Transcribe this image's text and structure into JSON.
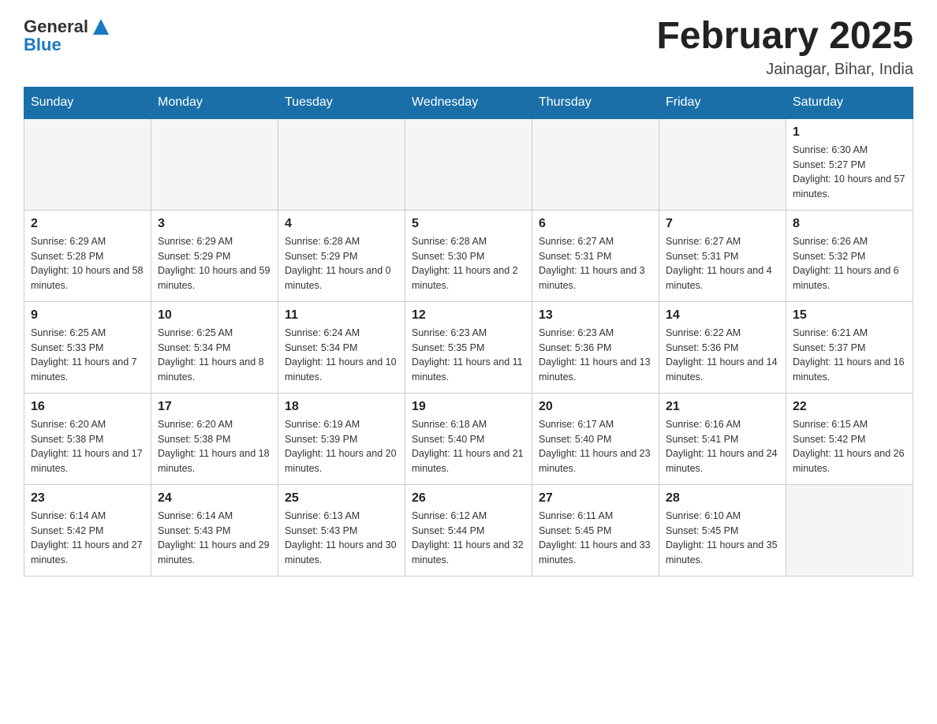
{
  "header": {
    "logo_general": "General",
    "logo_blue": "Blue",
    "month_title": "February 2025",
    "location": "Jainagar, Bihar, India"
  },
  "weekdays": [
    "Sunday",
    "Monday",
    "Tuesday",
    "Wednesday",
    "Thursday",
    "Friday",
    "Saturday"
  ],
  "weeks": [
    [
      {
        "day": "",
        "sunrise": "",
        "sunset": "",
        "daylight": ""
      },
      {
        "day": "",
        "sunrise": "",
        "sunset": "",
        "daylight": ""
      },
      {
        "day": "",
        "sunrise": "",
        "sunset": "",
        "daylight": ""
      },
      {
        "day": "",
        "sunrise": "",
        "sunset": "",
        "daylight": ""
      },
      {
        "day": "",
        "sunrise": "",
        "sunset": "",
        "daylight": ""
      },
      {
        "day": "",
        "sunrise": "",
        "sunset": "",
        "daylight": ""
      },
      {
        "day": "1",
        "sunrise": "Sunrise: 6:30 AM",
        "sunset": "Sunset: 5:27 PM",
        "daylight": "Daylight: 10 hours and 57 minutes."
      }
    ],
    [
      {
        "day": "2",
        "sunrise": "Sunrise: 6:29 AM",
        "sunset": "Sunset: 5:28 PM",
        "daylight": "Daylight: 10 hours and 58 minutes."
      },
      {
        "day": "3",
        "sunrise": "Sunrise: 6:29 AM",
        "sunset": "Sunset: 5:29 PM",
        "daylight": "Daylight: 10 hours and 59 minutes."
      },
      {
        "day": "4",
        "sunrise": "Sunrise: 6:28 AM",
        "sunset": "Sunset: 5:29 PM",
        "daylight": "Daylight: 11 hours and 0 minutes."
      },
      {
        "day": "5",
        "sunrise": "Sunrise: 6:28 AM",
        "sunset": "Sunset: 5:30 PM",
        "daylight": "Daylight: 11 hours and 2 minutes."
      },
      {
        "day": "6",
        "sunrise": "Sunrise: 6:27 AM",
        "sunset": "Sunset: 5:31 PM",
        "daylight": "Daylight: 11 hours and 3 minutes."
      },
      {
        "day": "7",
        "sunrise": "Sunrise: 6:27 AM",
        "sunset": "Sunset: 5:31 PM",
        "daylight": "Daylight: 11 hours and 4 minutes."
      },
      {
        "day": "8",
        "sunrise": "Sunrise: 6:26 AM",
        "sunset": "Sunset: 5:32 PM",
        "daylight": "Daylight: 11 hours and 6 minutes."
      }
    ],
    [
      {
        "day": "9",
        "sunrise": "Sunrise: 6:25 AM",
        "sunset": "Sunset: 5:33 PM",
        "daylight": "Daylight: 11 hours and 7 minutes."
      },
      {
        "day": "10",
        "sunrise": "Sunrise: 6:25 AM",
        "sunset": "Sunset: 5:34 PM",
        "daylight": "Daylight: 11 hours and 8 minutes."
      },
      {
        "day": "11",
        "sunrise": "Sunrise: 6:24 AM",
        "sunset": "Sunset: 5:34 PM",
        "daylight": "Daylight: 11 hours and 10 minutes."
      },
      {
        "day": "12",
        "sunrise": "Sunrise: 6:23 AM",
        "sunset": "Sunset: 5:35 PM",
        "daylight": "Daylight: 11 hours and 11 minutes."
      },
      {
        "day": "13",
        "sunrise": "Sunrise: 6:23 AM",
        "sunset": "Sunset: 5:36 PM",
        "daylight": "Daylight: 11 hours and 13 minutes."
      },
      {
        "day": "14",
        "sunrise": "Sunrise: 6:22 AM",
        "sunset": "Sunset: 5:36 PM",
        "daylight": "Daylight: 11 hours and 14 minutes."
      },
      {
        "day": "15",
        "sunrise": "Sunrise: 6:21 AM",
        "sunset": "Sunset: 5:37 PM",
        "daylight": "Daylight: 11 hours and 16 minutes."
      }
    ],
    [
      {
        "day": "16",
        "sunrise": "Sunrise: 6:20 AM",
        "sunset": "Sunset: 5:38 PM",
        "daylight": "Daylight: 11 hours and 17 minutes."
      },
      {
        "day": "17",
        "sunrise": "Sunrise: 6:20 AM",
        "sunset": "Sunset: 5:38 PM",
        "daylight": "Daylight: 11 hours and 18 minutes."
      },
      {
        "day": "18",
        "sunrise": "Sunrise: 6:19 AM",
        "sunset": "Sunset: 5:39 PM",
        "daylight": "Daylight: 11 hours and 20 minutes."
      },
      {
        "day": "19",
        "sunrise": "Sunrise: 6:18 AM",
        "sunset": "Sunset: 5:40 PM",
        "daylight": "Daylight: 11 hours and 21 minutes."
      },
      {
        "day": "20",
        "sunrise": "Sunrise: 6:17 AM",
        "sunset": "Sunset: 5:40 PM",
        "daylight": "Daylight: 11 hours and 23 minutes."
      },
      {
        "day": "21",
        "sunrise": "Sunrise: 6:16 AM",
        "sunset": "Sunset: 5:41 PM",
        "daylight": "Daylight: 11 hours and 24 minutes."
      },
      {
        "day": "22",
        "sunrise": "Sunrise: 6:15 AM",
        "sunset": "Sunset: 5:42 PM",
        "daylight": "Daylight: 11 hours and 26 minutes."
      }
    ],
    [
      {
        "day": "23",
        "sunrise": "Sunrise: 6:14 AM",
        "sunset": "Sunset: 5:42 PM",
        "daylight": "Daylight: 11 hours and 27 minutes."
      },
      {
        "day": "24",
        "sunrise": "Sunrise: 6:14 AM",
        "sunset": "Sunset: 5:43 PM",
        "daylight": "Daylight: 11 hours and 29 minutes."
      },
      {
        "day": "25",
        "sunrise": "Sunrise: 6:13 AM",
        "sunset": "Sunset: 5:43 PM",
        "daylight": "Daylight: 11 hours and 30 minutes."
      },
      {
        "day": "26",
        "sunrise": "Sunrise: 6:12 AM",
        "sunset": "Sunset: 5:44 PM",
        "daylight": "Daylight: 11 hours and 32 minutes."
      },
      {
        "day": "27",
        "sunrise": "Sunrise: 6:11 AM",
        "sunset": "Sunset: 5:45 PM",
        "daylight": "Daylight: 11 hours and 33 minutes."
      },
      {
        "day": "28",
        "sunrise": "Sunrise: 6:10 AM",
        "sunset": "Sunset: 5:45 PM",
        "daylight": "Daylight: 11 hours and 35 minutes."
      },
      {
        "day": "",
        "sunrise": "",
        "sunset": "",
        "daylight": ""
      }
    ]
  ]
}
